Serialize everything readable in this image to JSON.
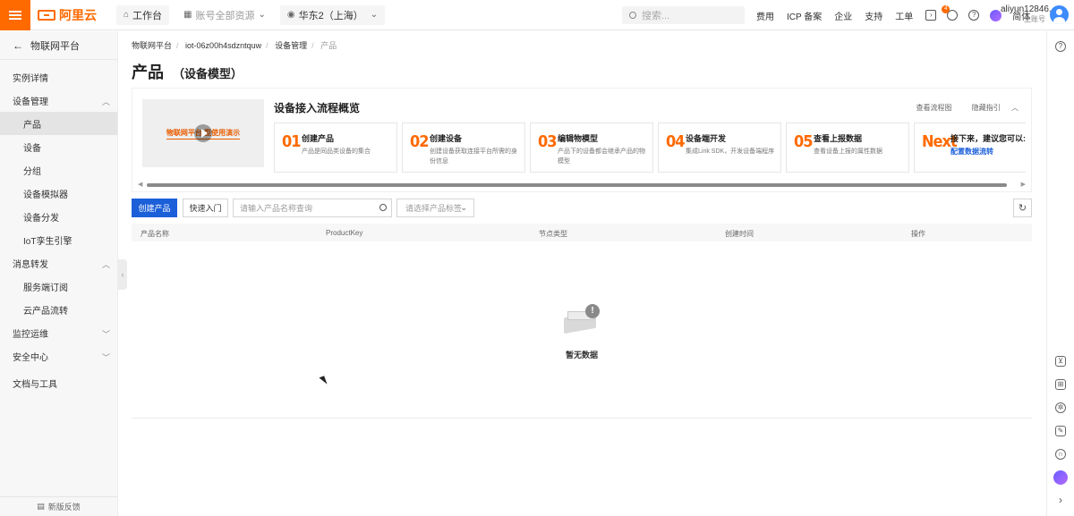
{
  "topbar": {
    "logo_text": "阿里云",
    "workbench": "工作台",
    "resource_group": "账号全部资源",
    "region": "华东2（上海）",
    "search_placeholder": "搜索...",
    "links": [
      "费用",
      "ICP 备案",
      "企业",
      "支持",
      "工单"
    ],
    "notification_count": "4",
    "language": "简体",
    "username": "aliyun12846...",
    "account_type": "主账号"
  },
  "sidebar": {
    "back_label": "物联网平台",
    "items": [
      {
        "label": "实例详情",
        "level": 1
      },
      {
        "label": "设备管理",
        "level": 1,
        "expanded": true
      },
      {
        "label": "产品",
        "level": 2,
        "active": true
      },
      {
        "label": "设备",
        "level": 2
      },
      {
        "label": "分组",
        "level": 2
      },
      {
        "label": "设备模拟器",
        "level": 2
      },
      {
        "label": "设备分发",
        "level": 2
      },
      {
        "label": "IoT孪生引擎",
        "level": 2
      },
      {
        "label": "消息转发",
        "level": 1,
        "expanded": true
      },
      {
        "label": "服务端订阅",
        "level": 2
      },
      {
        "label": "云产品流转",
        "level": 2
      },
      {
        "label": "监控运维",
        "level": 1,
        "expanded": false
      },
      {
        "label": "安全中心",
        "level": 1,
        "expanded": false
      },
      {
        "label": "文档与工具",
        "level": 1
      }
    ],
    "feedback": "新版反馈"
  },
  "breadcrumb": [
    "物联网平台",
    "iot-06z00h4sdzntquw",
    "设备管理",
    "产品"
  ],
  "page": {
    "title": "产品",
    "subtitle": "（设备模型）"
  },
  "overview": {
    "video_text": "物联网平台 型使用演示",
    "title": "设备接入流程概览",
    "link_flowchart": "查看流程图",
    "link_hide": "隐藏指引",
    "steps": [
      {
        "num": "01",
        "title": "创建产品",
        "desc": "产品是同品类设备的集合"
      },
      {
        "num": "02",
        "title": "创建设备",
        "desc": "创建设备获取连接平台所需的身份信息"
      },
      {
        "num": "03",
        "title": "编辑物模型",
        "desc": "产品下的设备都会继承产品的物模型"
      },
      {
        "num": "04",
        "title": "设备端开发",
        "desc": "集成Link SDK，开发设备端程序"
      },
      {
        "num": "05",
        "title": "查看上报数据",
        "desc": "查看设备上报的属性数据"
      },
      {
        "num": "Next",
        "title": "接下来，建议您可以:",
        "desc": "配置数据流转"
      }
    ]
  },
  "toolbar": {
    "create_product": "创建产品",
    "quick_start": "快速入门",
    "search_placeholder": "请输入产品名称查询",
    "tag_placeholder": "请选择产品标签"
  },
  "table": {
    "columns": [
      "产品名称",
      "ProductKey",
      "节点类型",
      "创建时间",
      "操作"
    ],
    "empty_text": "暂无数据"
  },
  "colors": {
    "brand": "#ff6a00",
    "primary": "#1b5fd9"
  }
}
